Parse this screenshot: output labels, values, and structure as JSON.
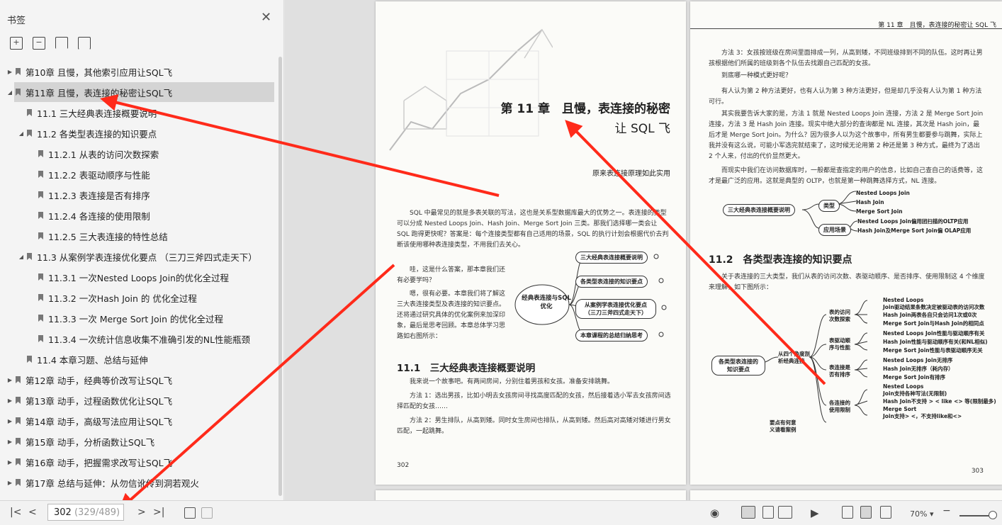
{
  "sidebar": {
    "title": "书签",
    "close_icon": "close-icon",
    "tool_icons": [
      "add-bookmark-icon",
      "remove-bookmark-icon",
      "bookmark-plus-icon",
      "bookmark-icon"
    ],
    "items": [
      {
        "label": "第10章 且慢，其他索引应用让SQL飞",
        "expand": "▶"
      },
      {
        "label": "第11章 且慢，表连接的秘密让SQL飞",
        "expand": "◢"
      },
      {
        "label": "11.1 三大经典表连接概要说明",
        "expand": ""
      },
      {
        "label": "11.2 各类型表连接的知识要点",
        "expand": "◢"
      },
      {
        "label": "11.2.1 从表的访问次数探索",
        "expand": ""
      },
      {
        "label": "11.2.2 表驱动顺序与性能",
        "expand": ""
      },
      {
        "label": "11.2.3 表连接是否有排序",
        "expand": ""
      },
      {
        "label": "11.2.4 各连接的使用限制",
        "expand": ""
      },
      {
        "label": "11.2.5 三大表连接的特性总结",
        "expand": ""
      },
      {
        "label": "11.3 从案例学表连接优化要点 （三刀三斧四式走天下）",
        "expand": "◢"
      },
      {
        "label": "11.3.1 一次Nested Loops Join的优化全过程",
        "expand": ""
      },
      {
        "label": "11.3.2 一次Hash Join 的 优化全过程",
        "expand": ""
      },
      {
        "label": "11.3.3 一次 Merge Sort Join 的优化全过程",
        "expand": ""
      },
      {
        "label": "11.3.4 一次统计信息收集不准确引发的NL性能瓶颈",
        "expand": ""
      },
      {
        "label": "11.4 本章习题、总结与延伸",
        "expand": ""
      },
      {
        "label": "第12章 动手，经典等价改写让SQL飞",
        "expand": "▶"
      },
      {
        "label": "第13章 动手，过程函数优化让SQL飞",
        "expand": "▶"
      },
      {
        "label": "第14章 动手，高级写法应用让SQL飞",
        "expand": "▶"
      },
      {
        "label": "第15章 动手，分析函数让SQL飞",
        "expand": "▶"
      },
      {
        "label": "第16章 动手，把握需求改写让SQL飞",
        "expand": "▶"
      },
      {
        "label": "第17章 总结与延伸：从勿信讹传到洞若观火",
        "expand": "▶"
      }
    ]
  },
  "left_page": {
    "chapter_title_line1": "第 11 章　且慢，表连接的秘密",
    "chapter_title_line2": "让 SQL 飞",
    "subtitle": "原来表连接原理如此实用",
    "intro_p1": "SQL 中最常见的就是多表关联的写法，这也是关系型数据库最大的优势之一。表连接的类型可以分成 Nested Loops Join、Hash Join、Merge Sort Join 三类。那我们选择哪一类会让 SQL 跑得更快呢？答案是：每个连接类型都有自己适用的场景，SQL 的执行计划会根据代价去判断该使用哪种表连接类型，不用我们去关心。",
    "intro_p2": "哇，这是什么答案，那本章我们还有必要学吗？",
    "intro_p3": "嗯，很有必要。本章我们将了解这三大表连接类型及表连接的知识要点。还将通过研究具体的优化案例来加深印象，最后是思考回顾。本章总体学习思路如右图所示：",
    "mm_center": "经典表连接与SQL优化",
    "mm_nodes": [
      "三大经典表连接概要说明",
      "各类型表连接的知识要点",
      "从案例学表连接优化要点（三刀三斧四式走天下）",
      "本章课程的总结归纳思考"
    ],
    "section_title": "11.1　三大经典表连接概要说明",
    "sec_p1": "我来说一个故事吧。有两间房间，分别住着男孩和女孩。准备安排跳舞。",
    "sec_p2": "方法 1：选出男孩，比如小明去女孩房间寻找高度匹配的女孩，然后接着选小军去女孩房间选择匹配的女孩……",
    "sec_p3": "方法 2：男生排队，从高到矮。同时女生房间也排队，从高到矮。然后高对高矮对矮进行男女匹配，一起跳舞。",
    "page_number": "302"
  },
  "right_page": {
    "running_head": "第 11 章　且慢，表连接的秘密让 SQL 飞",
    "p1": "方法 3：女孩按班级在房间里面排成一列，从高到矮，不同班级排到不同的队伍。这时再让男孩根据他们所属的班级到各个队伍去找跟自己匹配的女孩。",
    "p2": "到底哪一种模式更好呢？",
    "p3": "有人认为第 2 种方法更好，也有人认为第 3 种方法更好，但是却几乎没有人认为第 1 种方法可行。",
    "p4": "其实我要告诉大家的是，方法 1 就是 Nested Loops Join 连接，方法 2 是 Merge Sort Join 连接，方法 3 是 Hash Join 连接。现实中绝大部分的查询都是 NL 连接，其次是 Hash join，最后才是 Merge Sort Join。为什么？因为很多人以为这个故事中，所有男生都要参与跳舞，实际上我并没有这么说，可能小军选完就结束了，这时候无论用第 2 种还是第 3 种方式，最终为了选出 2 个人来，付出的代价显然更大。",
    "p5": "而现实中我们在访问数据库时，一般都是查指定的用户的信息，比如自己查自己的话费等，这才是最广泛的应用。这就是典型的 OLTP，也就是第一种跳舞选择方式，NL 连接。",
    "mm1_root": "三大经典表连接概要说明",
    "mm1_type": "类型",
    "mm1_scene": "应用场景",
    "mm1_types": [
      "Nested Loops Join",
      "Hash Join",
      "Merge Sort Join"
    ],
    "mm1_scenes": [
      "Nested Loops Join偏用团扫描的OLTP应用",
      "Hash Join及Merge Sort Join偏 OLAP应用"
    ],
    "section_title": "11.2　各类型表连接的知识要点",
    "sec_intro": "关于表连接的三大类型，我们从表的访问次数、表驱动顺序、是否排序、使用限制这 4 个维度来理解，如下图所示：",
    "mm2_root": "各类型表连接的知识要点",
    "mm2_mid": "从四个角度剖析经典连接",
    "mm2_branches": [
      "表的访问次数探索",
      "表驱动顺序与性能",
      "表连接是否有排序",
      "各连接的使用限制"
    ],
    "mm2_bottom": "要点有何意义请看案例",
    "mm2_leaves": [
      "Nested Loops",
      "Join驱动结果条数决定被驱动表的访问次数",
      "Hash Join两表各自只会访问1次或0次",
      "Merge Sort Join与Hash Join的相同点",
      "Nested Loops Join性能与驱动顺序有关",
      "Hash Join性能与驱动顺序有关(和NL相似)",
      "Merge Sort Join性能与表驱动顺序无关",
      "Nested Loops Join无排序",
      "Hash Join无排序（耗内存）",
      "Merge Sort Join有排序",
      "Nested Loops",
      "Join支持各种写法(无限制)",
      "Hash Join不支持 > < like <> 等(限制最多)",
      "Merge Sort",
      "Join支持> <，不支持like和<>"
    ],
    "page_number": "303"
  },
  "bottombar": {
    "page_current": "302",
    "page_total": "(329/489)",
    "zoom": "70%",
    "nav_icons": [
      "first-page-icon",
      "prev-page-icon",
      "next-page-icon",
      "last-page-icon"
    ],
    "view_icons": [
      "eye-icon",
      "single-page-icon",
      "continuous-icon",
      "two-page-icon",
      "play-icon",
      "actual-size-icon",
      "fit-page-icon",
      "fit-width-icon"
    ]
  },
  "colors": {
    "annotation_arrow": "#ff2a1a",
    "selected_row": "#d4d4d4"
  }
}
